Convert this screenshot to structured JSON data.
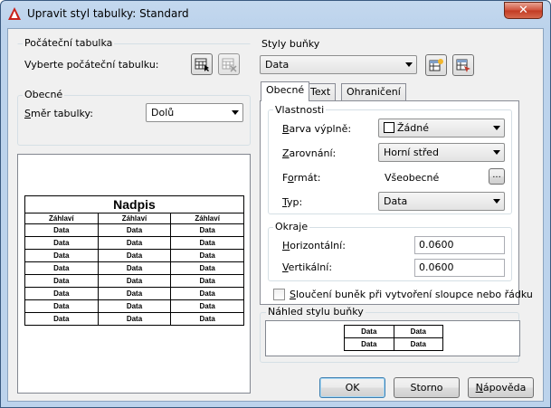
{
  "window": {
    "title": "Upravit styl tabulky: Standard",
    "close_glyph": "✕"
  },
  "left": {
    "start_table": {
      "group_title": "Počáteční tabulka",
      "select_label": "Vyberte počáteční tabulku:"
    },
    "general": {
      "group_title": "Obecné",
      "direction_label_u": "S",
      "direction_label_rest": "měr tabulky:",
      "direction_value": "Dolů"
    },
    "preview_table": {
      "title": "Nadpis",
      "headers": [
        "Záhlaví",
        "Záhlaví",
        "Záhlaví"
      ],
      "rows": [
        [
          "Data",
          "Data",
          "Data"
        ],
        [
          "Data",
          "Data",
          "Data"
        ],
        [
          "Data",
          "Data",
          "Data"
        ],
        [
          "Data",
          "Data",
          "Data"
        ],
        [
          "Data",
          "Data",
          "Data"
        ],
        [
          "Data",
          "Data",
          "Data"
        ],
        [
          "Data",
          "Data",
          "Data"
        ],
        [
          "Data",
          "Data",
          "Data"
        ]
      ]
    }
  },
  "right": {
    "cell_styles": {
      "group_title": "Styly buňky",
      "value": "Data"
    },
    "tabs": [
      "Obecné",
      "Text",
      "Ohraničení"
    ],
    "properties": {
      "group_title": "Vlastnosti",
      "fill_u": "B",
      "fill_rest": "arva výplně:",
      "fill_value": "Žádné",
      "align_u": "Z",
      "align_rest": "arovnání:",
      "align_value": "Horní střed",
      "format_pre": "F",
      "format_u": "o",
      "format_rest": "rmát:",
      "format_value": "Všeobecné",
      "format_button": "...",
      "type_u": "T",
      "type_rest": "yp:",
      "type_value": "Data"
    },
    "margins": {
      "group_title": "Okraje",
      "horizontal_u": "H",
      "horizontal_rest": "orizontální:",
      "horizontal_value": "0.0600",
      "vertical_u": "V",
      "vertical_rest": "ertikální:",
      "vertical_value": "0.0600"
    },
    "merge_checkbox": {
      "label_u": "S",
      "label_rest": "loučení buněk při vytvoření sloupce nebo řádku",
      "checked": false
    },
    "cell_preview": {
      "group_title": "Náhled stylu buňky",
      "rows": [
        [
          "Data",
          "Data"
        ],
        [
          "Data",
          "Data"
        ]
      ]
    }
  },
  "buttons": {
    "ok": "OK",
    "cancel": "Storno",
    "help_u": "N",
    "help_rest": "ápověda"
  }
}
